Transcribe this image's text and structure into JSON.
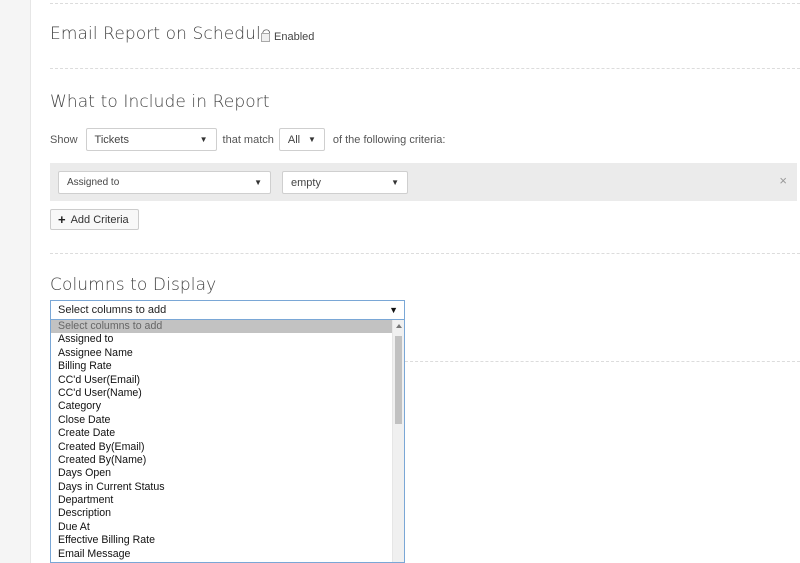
{
  "email_schedule": {
    "title": "Email Report on Schedule",
    "checkbox_label": "Enabled"
  },
  "include": {
    "title": "What to Include in Report",
    "show_label": "Show",
    "show_value": "Tickets",
    "match_label": "that match",
    "match_value": "All",
    "criteria_suffix": "of the following criteria:"
  },
  "criteria": {
    "field_value": "Assigned to",
    "operator_value": "empty",
    "remove_icon": "×",
    "add_button_label": "Add Criteria",
    "add_icon": "+"
  },
  "columns": {
    "title": "Columns to Display",
    "select_value": "Select columns to add",
    "options": [
      "Select columns to add",
      "Assigned to",
      "Assignee Name",
      "Billing Rate",
      "CC'd User(Email)",
      "CC'd User(Name)",
      "Category",
      "Close Date",
      "Create Date",
      "Created By(Email)",
      "Created By(Name)",
      "Days Open",
      "Days in Current Status",
      "Department",
      "Description",
      "Due At",
      "Effective Billing Rate",
      "Email Message"
    ]
  }
}
